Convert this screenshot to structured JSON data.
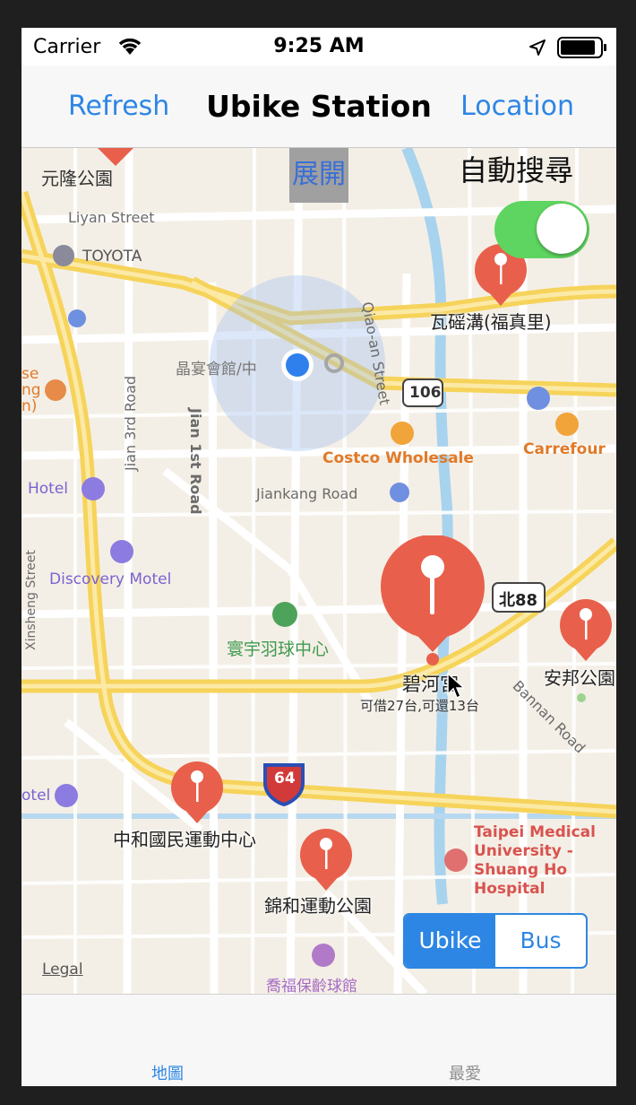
{
  "status_bar": {
    "carrier": "Carrier",
    "time": "9:25 AM"
  },
  "nav": {
    "left_button": "Refresh",
    "title": "Ubike Station",
    "right_button": "Location"
  },
  "map_controls": {
    "expand_button": "展開",
    "auto_search_label": "自動搜尋",
    "auto_search_on": true,
    "legal": "Legal"
  },
  "segment": {
    "options": [
      "Ubike",
      "Bus"
    ],
    "selected": "Ubike"
  },
  "map_labels": {
    "yuanlong_park": "元隆公園",
    "liyan_street": "Liyan Street",
    "toyota": "TOYOTA",
    "qiaoan_street": "Qiao-an Street",
    "jingyan_hall": "晶宴會館/中",
    "route_106": "106",
    "jian_3rd_road": "Jian 3rd Road",
    "jian_1st_road": "Jian 1st Road",
    "costco": "Costco Wholesale",
    "carrefour": "Carrefour",
    "jiankang_road": "Jiankang Road",
    "hotel_left": "Hotel",
    "discovery_motel": "Discovery Motel",
    "xinsheng_street": "Xinsheng Street",
    "route_bei88": "北88",
    "huanyu_badminton": "寰宇羽球中心",
    "bannan_road": "Bannan Road",
    "route_64": "64",
    "otel_left": "otel",
    "taipei_medical": "Taipei Medical\nUniversity -\nShuang Ho\nHospital",
    "qiaofu_bowling": "喬福保齡球館",
    "edge_text": "se\nng\nn)"
  },
  "stations": [
    {
      "name": "瓦磘溝(福真里)"
    },
    {
      "name": "碧河宮",
      "detail": "可借27台,可還13台",
      "selected": true
    },
    {
      "name": "安邦公園"
    },
    {
      "name": "中和國民運動中心"
    },
    {
      "name": "錦和運動公園"
    }
  ],
  "tabs": [
    {
      "label": "地圖",
      "active": true
    },
    {
      "label": "最愛",
      "active": false
    }
  ],
  "colors": {
    "accent": "#2d86e4",
    "pin": "#e8604c",
    "toggle_on": "#5fd561",
    "user_location": "#2f80ed"
  }
}
